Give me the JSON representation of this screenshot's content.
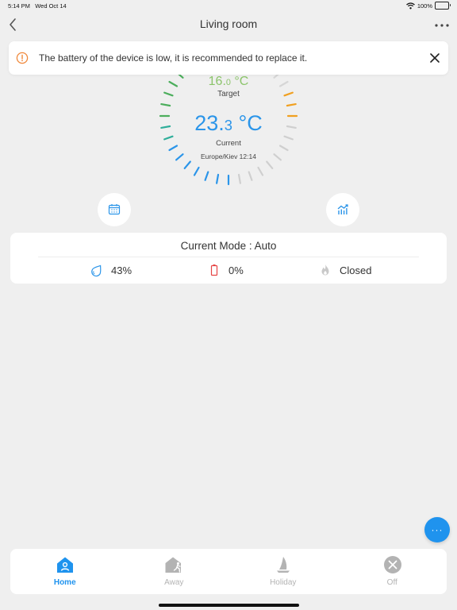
{
  "status_bar": {
    "time": "5:14 PM",
    "date": "Wed Oct 14",
    "battery_percent": "100%"
  },
  "header": {
    "title": "Living room",
    "back_icon": "chevron-left-icon",
    "more_icon": "more-horizontal-icon"
  },
  "alert": {
    "message": "The battery of the device is low, it is recommended to replace it.",
    "icon": "info-circle-icon",
    "close_icon": "close-icon",
    "icon_color": "#f0883a"
  },
  "thermostat": {
    "target_whole": "16.",
    "target_decimal": "0",
    "target_unit": " °C",
    "target_label": "Target",
    "current_whole": "23.",
    "current_decimal": "3",
    "current_unit": " °C",
    "current_label": "Current",
    "timezone_time": "Europe/Kiev 12:14",
    "target_color": "#8bc46a",
    "current_color": "#2b95e9"
  },
  "actions": {
    "schedule_icon": "calendar-icon",
    "stats_icon": "bar-chart-icon"
  },
  "mode_card": {
    "title": "Current Mode : Auto",
    "humidity": "43%",
    "battery": "0%",
    "valve_status": "Closed"
  },
  "tabs": [
    {
      "label": "Home",
      "icon": "home-icon",
      "active": true
    },
    {
      "label": "Away",
      "icon": "away-icon",
      "active": false
    },
    {
      "label": "Holiday",
      "icon": "sailboat-icon",
      "active": false
    },
    {
      "label": "Off",
      "icon": "off-icon",
      "active": false
    }
  ],
  "fab": {
    "icon": "more-icon",
    "label": "···"
  },
  "colors": {
    "accent": "#1f93ee",
    "warning": "#f0883a",
    "danger": "#e64545",
    "inactive": "#b3b3b3"
  }
}
